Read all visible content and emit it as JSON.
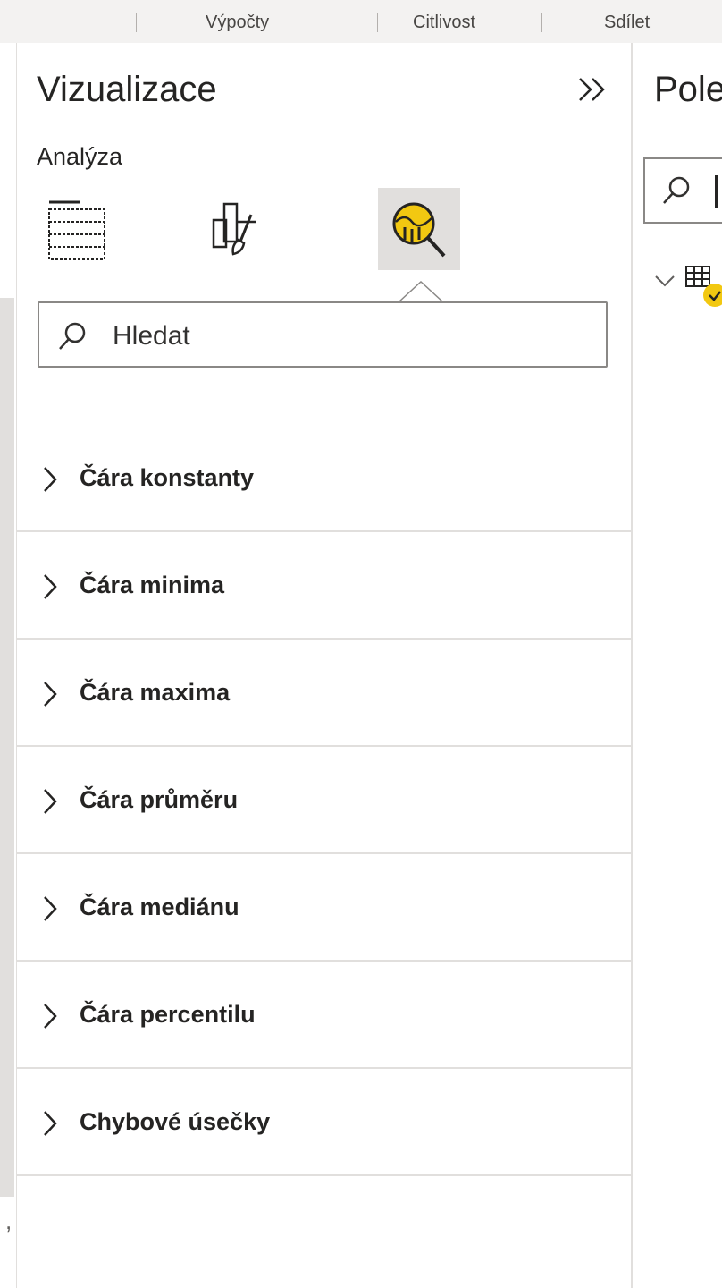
{
  "ribbon": {
    "items": [
      "Výpočty",
      "Citlivost",
      "Sdílet"
    ]
  },
  "left_edge": {
    "text": ","
  },
  "visualizations": {
    "title": "Vizualizace",
    "section": "Analýza",
    "tools": [
      {
        "name": "build-visual",
        "icon": "fields-grid-icon"
      },
      {
        "name": "format-visual",
        "icon": "paintbrush-format-icon"
      },
      {
        "name": "analytics",
        "icon": "analytics-magnifier-icon",
        "active": true
      }
    ],
    "search": {
      "placeholder": "Hledat"
    },
    "accordion": [
      {
        "label": "Čára konstanty"
      },
      {
        "label": "Čára minima"
      },
      {
        "label": "Čára maxima"
      },
      {
        "label": "Čára průměru"
      },
      {
        "label": "Čára mediánu"
      },
      {
        "label": "Čára percentilu"
      },
      {
        "label": "Chybové úsečky"
      }
    ]
  },
  "fields": {
    "title": "Pole"
  },
  "colors": {
    "accent_yellow": "#f2c811",
    "active_tab_bg": "#e1dfdd",
    "divider": "#e1dfdd"
  }
}
